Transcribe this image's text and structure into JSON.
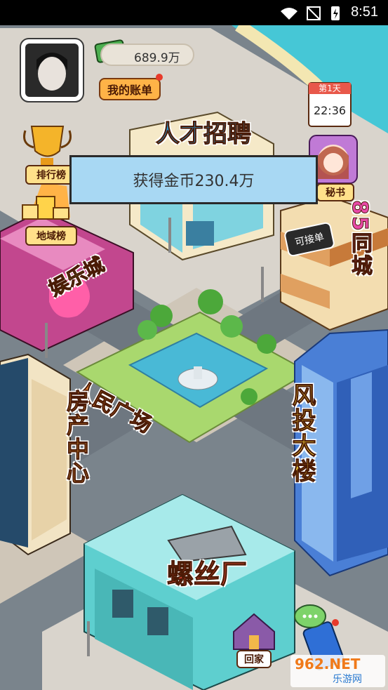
{
  "status_bar": {
    "time": "8:51"
  },
  "hud": {
    "money": "689.9万",
    "account_label": "我的账单",
    "ranking_label": "排行榜",
    "region_label": "地域榜",
    "calendar_day": "第1天",
    "calendar_time": "22:36",
    "secretary_label": "秘书",
    "home_label": "回家"
  },
  "toast": {
    "message": "获得金币230.4万"
  },
  "buildings": {
    "talent": "人才招聘",
    "entertainment": "娱乐城",
    "city85": "85同城",
    "accept_order": "可接单",
    "plaza": "人民广场",
    "realestate": "房产中心",
    "venture": "风投大楼",
    "screw": "螺丝厂"
  },
  "watermark": {
    "top": "962.NET",
    "bottom": "乐游网"
  }
}
